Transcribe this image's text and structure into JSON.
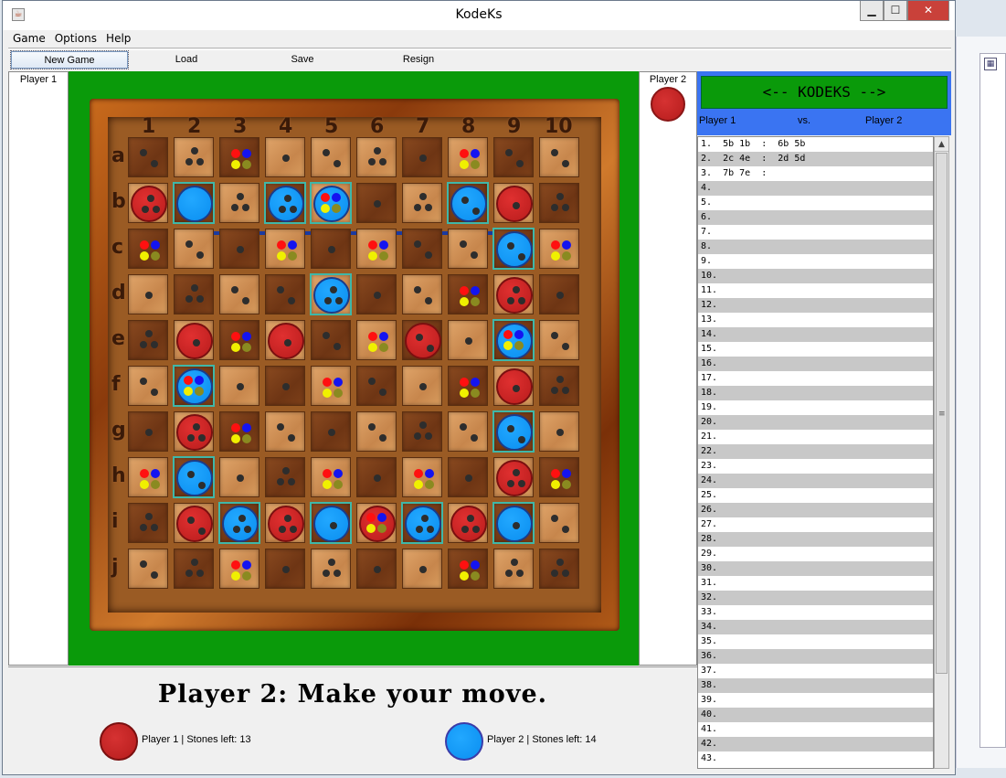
{
  "window": {
    "title": "KodeKs",
    "min": "▁",
    "max": "☐",
    "close": "✕",
    "icon": "java-app-icon"
  },
  "menu": [
    "Game",
    "Options",
    "Help"
  ],
  "toolbar": {
    "new_game": "New Game",
    "load": "Load",
    "save": "Save",
    "resign": "Resign"
  },
  "players": {
    "p1_label": "Player 1",
    "p2_label": "Player 2"
  },
  "board": {
    "col_labels": [
      "1",
      "2",
      "3",
      "4",
      "5",
      "6",
      "7",
      "8",
      "9",
      "10"
    ],
    "row_labels": [
      "a",
      "b",
      "c",
      "d",
      "e",
      "f",
      "g",
      "h",
      "i",
      "j"
    ],
    "shading": [
      "DLDLLLDLDL",
      "LDLDLDLDLD",
      "DLDLDLDLDL",
      "LDLDLDLDLD",
      "DLDLDLDLDL",
      "LDLDLDLDLD",
      "DLDLDLDLDL",
      "LDLDLDLDLD",
      "DLDLDLDLDL",
      "LDLDLDLDLD"
    ],
    "cells": [
      [
        "d2",
        "d3",
        "c",
        "d1",
        "d2",
        "d3",
        "d1",
        "c",
        "d2",
        "d2"
      ],
      [
        "Rd3",
        "B",
        "d3",
        "Bd3",
        "Bc",
        "d1",
        "d3",
        "Bd2",
        "Rd1",
        "d3"
      ],
      [
        "c",
        "d2",
        "d1",
        "c",
        "d1",
        "c",
        "d2",
        "d2",
        "Bd2",
        "c"
      ],
      [
        "d1",
        "d3",
        "d2",
        "d2",
        "Bd3",
        "d1",
        "d2",
        "c",
        "Rd3",
        "d1"
      ],
      [
        "d3",
        "Rd1",
        "c",
        "Rd1",
        "d2",
        "c",
        "Rd2",
        "d1",
        "Bc",
        "d2"
      ],
      [
        "d2",
        "Bc",
        "d1",
        "d1",
        "c",
        "d2",
        "d1",
        "c",
        "Rd1",
        "d3"
      ],
      [
        "d1",
        "Rd3",
        "c",
        "d2",
        "d1",
        "d2",
        "d3",
        "d2",
        "Bd2",
        "d1"
      ],
      [
        "c",
        "Bd2",
        "d1",
        "d3",
        "c",
        "d1",
        "c",
        "d1",
        "Rd3",
        "c"
      ],
      [
        "d3",
        "Rd2",
        "Bd3",
        "Rd3",
        "Bd1",
        "Rc",
        "Bd3",
        "Rd3",
        "Bd1",
        "d2"
      ],
      [
        "d2",
        "d3",
        "c",
        "d1",
        "d3",
        "d1",
        "d1",
        "c",
        "d3",
        "d3"
      ]
    ],
    "highlight": [
      "1-1",
      "1-3",
      "1-4",
      "1-7",
      "2-8",
      "3-4",
      "4-8",
      "5-1",
      "6-8",
      "7-1",
      "8-2",
      "8-4",
      "8-6",
      "8-8"
    ],
    "colors": {
      "red": "#c41f1f",
      "blue": "#0a9af5",
      "dot": "#2d2d2d",
      "green": "#0a9a0a",
      "pip_red": "#ff1010",
      "pip_blue": "#1414f0",
      "pip_yellow": "#f0f000",
      "pip_olive": "#8a8a20"
    }
  },
  "status": {
    "message": "Player 2: Make your move.",
    "p1": "Player 1 | Stones left:  13",
    "p2": "Player 2 | Stones left:  14"
  },
  "moves": {
    "header": "<-- KODEKS -->",
    "player1": "Player 1",
    "vs": "vs.",
    "player2": "Player 2",
    "rows": [
      "1.  5b 1b  :  6b 5b",
      "2.  2c 4e  :  2d 5d",
      "3.  7b 7e  :",
      "4.",
      "5.",
      "6.",
      "7.",
      "8.",
      "9.",
      "10.",
      "11.",
      "12.",
      "13.",
      "14.",
      "15.",
      "16.",
      "17.",
      "18.",
      "19.",
      "20.",
      "21.",
      "22.",
      "23.",
      "24.",
      "25.",
      "26.",
      "27.",
      "28.",
      "29.",
      "30.",
      "31.",
      "32.",
      "33.",
      "34.",
      "35.",
      "36.",
      "37.",
      "38.",
      "39.",
      "40.",
      "41.",
      "42.",
      "43."
    ]
  }
}
